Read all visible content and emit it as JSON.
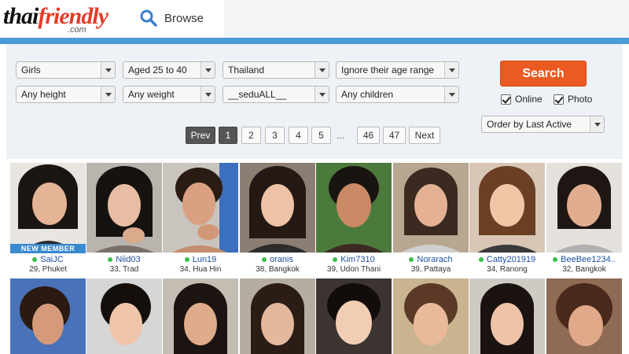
{
  "header": {
    "logo_text_a": "thai",
    "logo_text_b": "friendly",
    "logo_subtext": ".com",
    "browse_label": "Browse"
  },
  "filters": {
    "row1": [
      {
        "id": "gender",
        "value": "Girls"
      },
      {
        "id": "age",
        "value": "Aged 25 to 40"
      },
      {
        "id": "country",
        "value": "Thailand"
      },
      {
        "id": "age-range-pref",
        "value": "Ignore their age range"
      }
    ],
    "row2": [
      {
        "id": "height",
        "value": "Any height"
      },
      {
        "id": "weight",
        "value": "Any weight"
      },
      {
        "id": "education",
        "value": "__seduALL__"
      },
      {
        "id": "children",
        "value": "Any children"
      }
    ],
    "search_label": "Search",
    "online_label": "Online",
    "online_checked": true,
    "photo_label": "Photo",
    "photo_checked": true,
    "order_value": "Order by Last Active"
  },
  "pagination": {
    "prev": "Prev",
    "pages": [
      "1",
      "2",
      "3",
      "4",
      "5"
    ],
    "current": "1",
    "ellipsis": "...",
    "tail_pages": [
      "46",
      "47"
    ],
    "next": "Next"
  },
  "profiles": [
    {
      "name": "SaiJC",
      "info": "29, Phuket",
      "badge": "NEW MEMBER",
      "online": true
    },
    {
      "name": "Niid03",
      "info": "33, Trad",
      "online": true
    },
    {
      "name": "Lun19",
      "info": "34, Hua Hin",
      "online": true
    },
    {
      "name": "oranis",
      "info": "38, Bangkok",
      "online": true
    },
    {
      "name": "Kim7310",
      "info": "39, Udon Thani",
      "online": true
    },
    {
      "name": "Norarach",
      "info": "39, Pattaya",
      "online": true
    },
    {
      "name": "Catty201919",
      "info": "34, Ranong",
      "online": true
    },
    {
      "name": "BeeBee1234..",
      "info": "32, Bangkok",
      "online": true
    }
  ],
  "colors": {
    "accent_blue": "#4a9bd8",
    "search_orange": "#ec5a23",
    "link_blue": "#1e4f9c",
    "online_green": "#3bbf4a",
    "badge_blue": "#3a8ad0"
  }
}
